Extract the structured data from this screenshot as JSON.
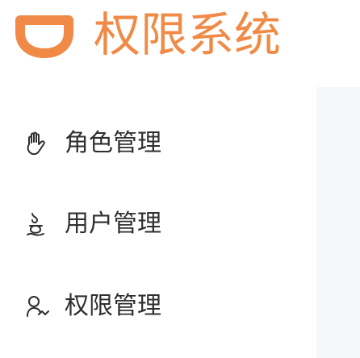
{
  "header": {
    "logo_icon": "didi-logo-icon",
    "title": "权限系统",
    "brand_color": "#f08a46"
  },
  "sidebar": {
    "items": [
      {
        "icon": "hand-icon",
        "label": "角色管理"
      },
      {
        "icon": "user-icon",
        "label": "用户管理"
      },
      {
        "icon": "permission-icon",
        "label": "权限管理"
      }
    ]
  },
  "colors": {
    "text": "#2f2f2f",
    "content_bg": "#f6f7fb"
  }
}
